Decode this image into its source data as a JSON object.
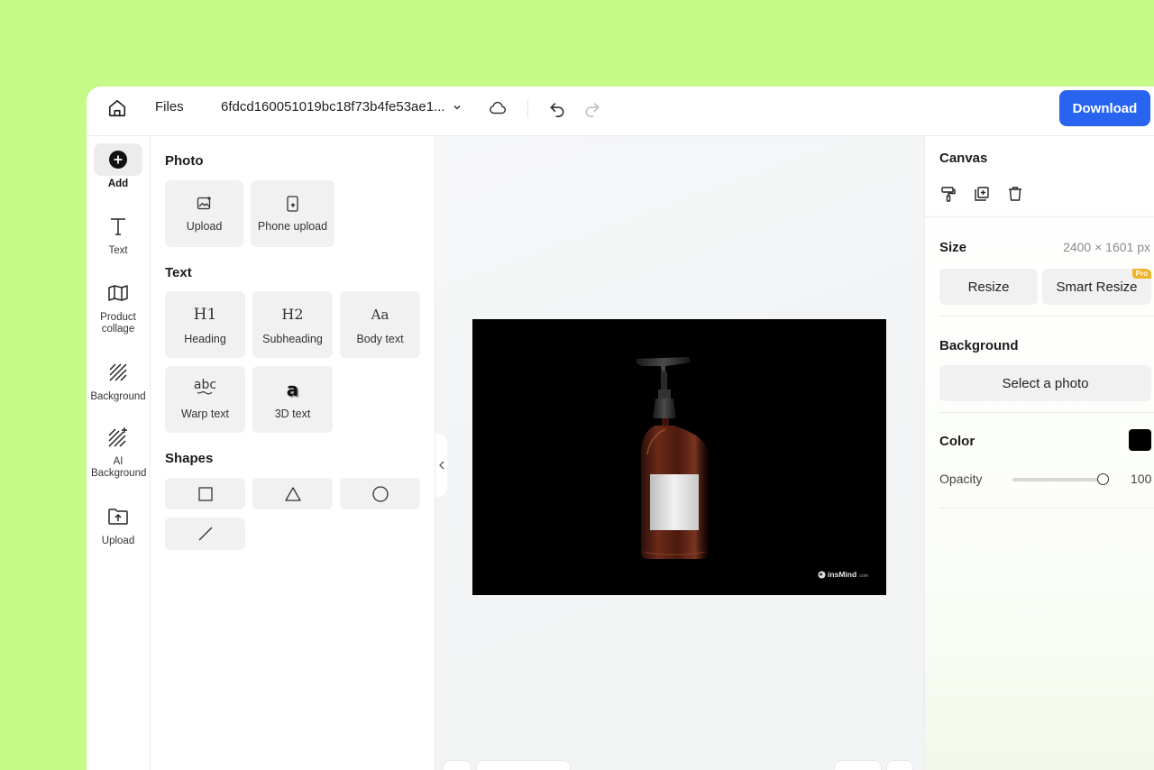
{
  "topbar": {
    "files_label": "Files",
    "filename": "6fdcd160051019bc18f73b4fe53ae1...",
    "download_label": "Download"
  },
  "rail": {
    "items": [
      {
        "label": "Add",
        "icon": "plus-circle-icon",
        "active": true
      },
      {
        "label": "Text",
        "icon": "text-icon"
      },
      {
        "label": "Product collage",
        "icon": "book-open-icon"
      },
      {
        "label": "Background",
        "icon": "hatch-icon"
      },
      {
        "label": "AI Background",
        "icon": "ai-hatch-icon"
      },
      {
        "label": "Upload",
        "icon": "folder-upload-icon"
      }
    ]
  },
  "panel": {
    "photo_title": "Photo",
    "photo_tiles": [
      "Upload",
      "Phone upload"
    ],
    "text_title": "Text",
    "text_tiles": [
      {
        "glyph": "H1",
        "label": "Heading"
      },
      {
        "glyph": "H2",
        "label": "Subheading"
      },
      {
        "glyph": "Aa",
        "label": "Body text"
      },
      {
        "glyph": "abc",
        "label": "Warp text"
      },
      {
        "glyph": "a",
        "label": "3D text"
      }
    ],
    "shapes_title": "Shapes"
  },
  "canvas": {
    "watermark": "insMind",
    "watermark_suffix": ".com",
    "background_color": "#000000"
  },
  "props": {
    "canvas_title": "Canvas",
    "size_title": "Size",
    "size_value": "2400 × 1601 px",
    "resize_label": "Resize",
    "smart_resize_label": "Smart Resize",
    "pro_badge": "Pro",
    "background_title": "Background",
    "select_photo_label": "Select a photo",
    "color_title": "Color",
    "opacity_label": "Opacity",
    "opacity_value": "100"
  },
  "colors": {
    "accent": "#2864f0",
    "page_bg": "#c6f988",
    "pro_badge": "#f0b429"
  }
}
